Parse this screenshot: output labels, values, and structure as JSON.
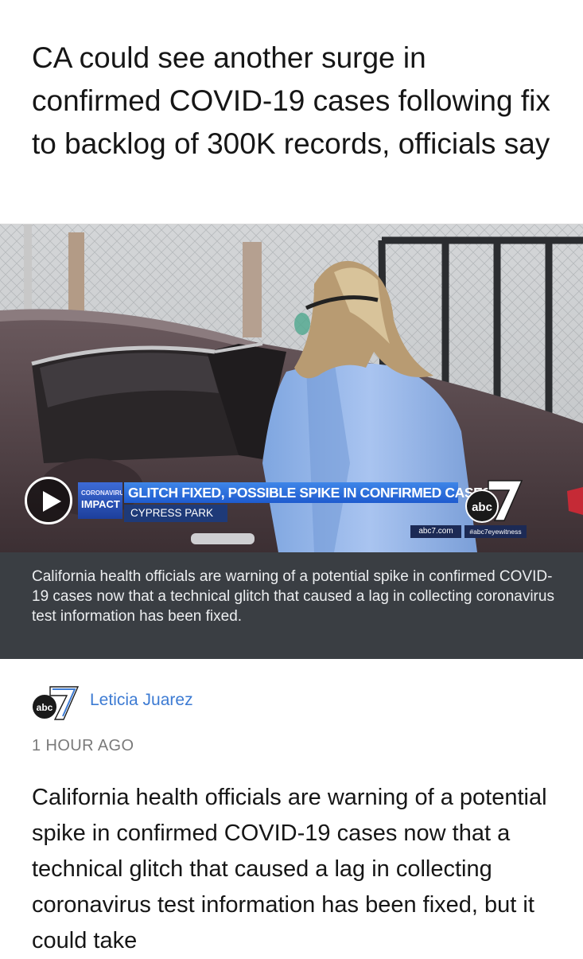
{
  "article": {
    "headline": "CA could see another surge in confirmed COVID-19 cases following fix to backlog of 300K records, officials say",
    "caption": "California health officials are warning of a potential spike in confirmed COVID-19 cases now that a technical glitch that caused a lag in collecting coronavirus test information has been fixed.",
    "author": "Leticia Juarez",
    "timestamp": "1 HOUR AGO",
    "body": "California health officials are warning of a potential spike in confirmed COVID-19 cases now that a technical glitch that caused a lag in collecting coronavirus test information has been fixed, but it could take"
  },
  "video": {
    "badge_line1": "CORONAVIRUS:",
    "badge_line2": "IMPACT",
    "headline_bar": "GLITCH FIXED, POSSIBLE SPIKE IN CONFIRMED CASES",
    "location": "CYPRESS PARK",
    "logo_text": "abc",
    "site": "abc7.com",
    "hashtag": "#abc7eyewitness",
    "play_icon": "play-icon"
  },
  "colors": {
    "author_link": "#3d7bd3",
    "caption_bg": "#3a3e43",
    "news_bar": "#2a6be0"
  }
}
